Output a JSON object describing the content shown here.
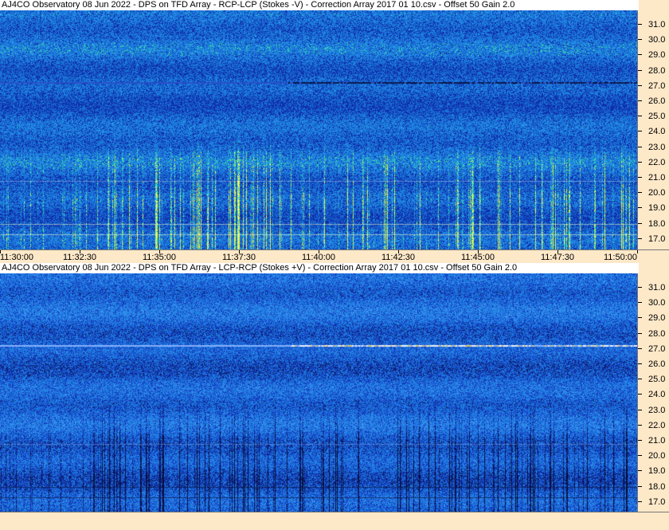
{
  "top_panel": {
    "title": "AJ4CO Observatory 08 Jun 2022  -  DPS on TFD Array  -  RCP-LCP (Stokes -V)  -  Correction Array 2017 01 10.csv  -  Offset 50  Gain 2.0",
    "mode": "RCP-LCP",
    "freq_labels": [
      "31.0",
      "30.0",
      "29.0",
      "28.0",
      "27.0",
      "26.0",
      "25.0",
      "24.0",
      "23.0",
      "22.0",
      "21.0",
      "20.0",
      "19.0",
      "18.0",
      "17.0"
    ]
  },
  "bottom_panel": {
    "title": "AJ4CO Observatory 08 Jun 2022  -  DPS on TFD Array  -  LCP-RCP (Stokes +V)  -  Correction Array 2017 01 10.csv  -  Offset 50  Gain 2.0",
    "mode": "LCP-RCP",
    "freq_labels": [
      "31.0",
      "30.0",
      "29.0",
      "28.0",
      "27.0",
      "26.0",
      "25.0",
      "24.0",
      "23.0",
      "22.0",
      "21.0",
      "20.0",
      "19.0",
      "18.0",
      "17.0"
    ]
  },
  "time_labels": [
    "11:30:00",
    "11:32:30",
    "11:35:00",
    "11:37:30",
    "11:40:00",
    "11:42:30",
    "11:45:00",
    "11:47:30",
    "11:50:00"
  ],
  "colors": {
    "background": "#1d4fd6",
    "axis_bg": "#fde8c8",
    "burst_hot": "#e8ff40",
    "burst_dark": "#061040"
  }
}
